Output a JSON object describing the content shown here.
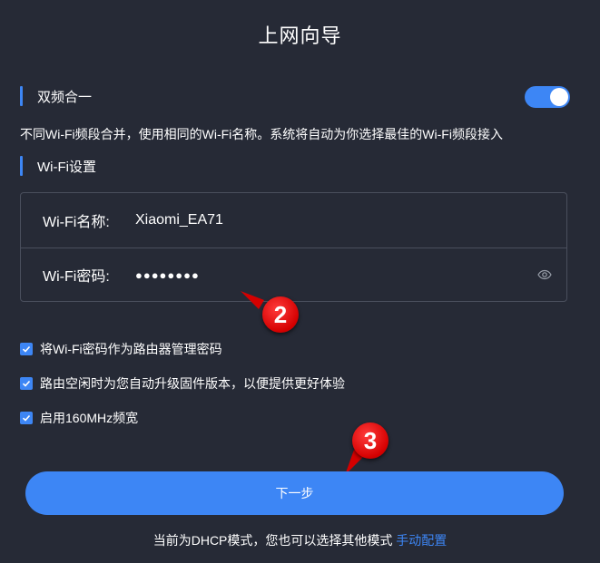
{
  "page": {
    "title": "上网向导"
  },
  "dual_band": {
    "section_label": "双频合一",
    "enabled": true,
    "description": "不同Wi-Fi频段合并，使用相同的Wi-Fi名称。系统将自动为你选择最佳的Wi-Fi频段接入"
  },
  "wifi_settings": {
    "section_label": "Wi-Fi设置",
    "name_label": "Wi-Fi名称:",
    "name_value": "Xiaomi_EA71",
    "password_label": "Wi-Fi密码:",
    "password_masked": "●●●●●●●●"
  },
  "options": [
    {
      "label": "将Wi-Fi密码作为路由器管理密码",
      "checked": true
    },
    {
      "label": "路由空闲时为您自动升级固件版本，以便提供更好体验",
      "checked": true
    },
    {
      "label": "启用160MHz频宽",
      "checked": true
    }
  ],
  "next_button_label": "下一步",
  "footer": {
    "text": "当前为DHCP模式，您也可以选择其他模式",
    "link_label": "手动配置"
  },
  "annotations": {
    "step2": "2",
    "step3": "3"
  },
  "colors": {
    "background": "#262a36",
    "accent": "#3d86f5",
    "border": "#4a4f5d",
    "callout": "#d40000"
  },
  "icons": {
    "password_toggle": "eye-icon",
    "checkbox": "check-icon"
  }
}
